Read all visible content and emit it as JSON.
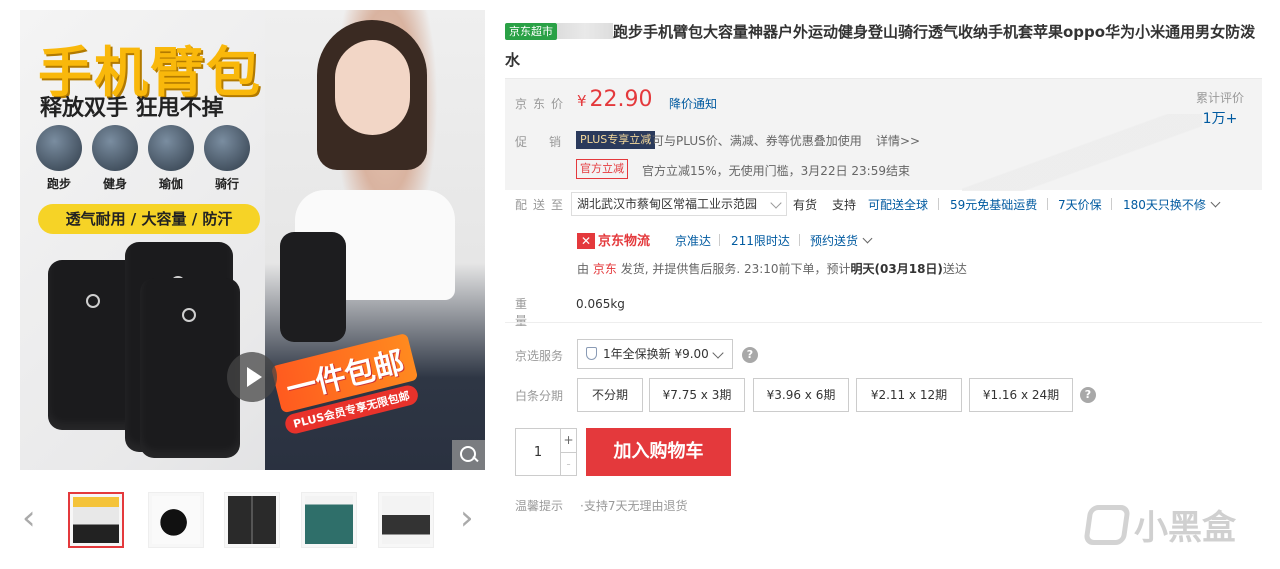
{
  "gallery": {
    "hero_title": "手机臂包",
    "hero_subtitle": "释放双手 狂甩不掉",
    "sports": [
      "跑步",
      "健身",
      "瑜伽",
      "骑行"
    ],
    "feature_band": "透气耐用 / 大容量 / 防汗",
    "promo_big": "一件包邮",
    "promo_small": "PLUS会员专享无限包邮",
    "prev_arrow": "‹",
    "next_arrow": "›",
    "thumbs": [
      "thumb-1",
      "thumb-2",
      "thumb-3",
      "thumb-4",
      "thumb-5"
    ]
  },
  "product": {
    "store_tag": "京东超市",
    "title": "跑步手机臂包大容量神器户外运动健身登山骑行透气收纳手机套苹果oppo华为小米通用男女防泼水"
  },
  "price": {
    "label": "京东价",
    "currency": "¥",
    "value": "22.90",
    "drop_notify": "降价通知",
    "reviews_label": "累计评价",
    "reviews_count": "1万+"
  },
  "promotion": {
    "label": "促销",
    "plus_tag": "PLUS专享立减",
    "plus_text": "可与PLUS价、满减、券等优惠叠加使用",
    "details": "详情>>",
    "official_tag": "官方立减",
    "official_text": "官方立减15%，无使用门槛，3月22日 23:59结束"
  },
  "delivery": {
    "label": "配送至",
    "address": "湖北武汉市蔡甸区常福工业示范园",
    "stock": "有货",
    "support": "支持",
    "options": [
      "可配送全球",
      "59元免基础运费",
      "7天价保",
      "180天只换不修"
    ],
    "logistics": "京东物流",
    "logistics_icon": "✕",
    "services": [
      "京准达",
      "211限时达",
      "预约送货"
    ],
    "ship_prefix": "由",
    "ship_seller": "京东",
    "ship_mid": "发货, 并提供售后服务. 23:10前下单，预计",
    "ship_date": "明天(03月18日)",
    "ship_suffix": "送达"
  },
  "weight": {
    "label": "重量",
    "value": "0.065kg"
  },
  "service": {
    "label": "京选服务",
    "option": "1年全保换新 ¥9.00",
    "help": "?"
  },
  "installment": {
    "label": "白条分期",
    "options": [
      "不分期",
      "¥7.75 x 3期",
      "¥3.96 x 6期",
      "¥2.11 x 12期",
      "¥1.16 x 24期"
    ],
    "help": "?"
  },
  "cart": {
    "quantity": "1",
    "plus": "+",
    "minus": "-",
    "add_to_cart": "加入购物车"
  },
  "tips": {
    "label": "温馨提示",
    "text": "·支持7天无理由退货"
  },
  "watermark": {
    "text": "小黑盒"
  },
  "colors": {
    "accent_red": "#e4393c",
    "link_blue": "#005aa0",
    "supermarket_green": "#2aa146",
    "plus_navy": "#2a3a5c"
  }
}
